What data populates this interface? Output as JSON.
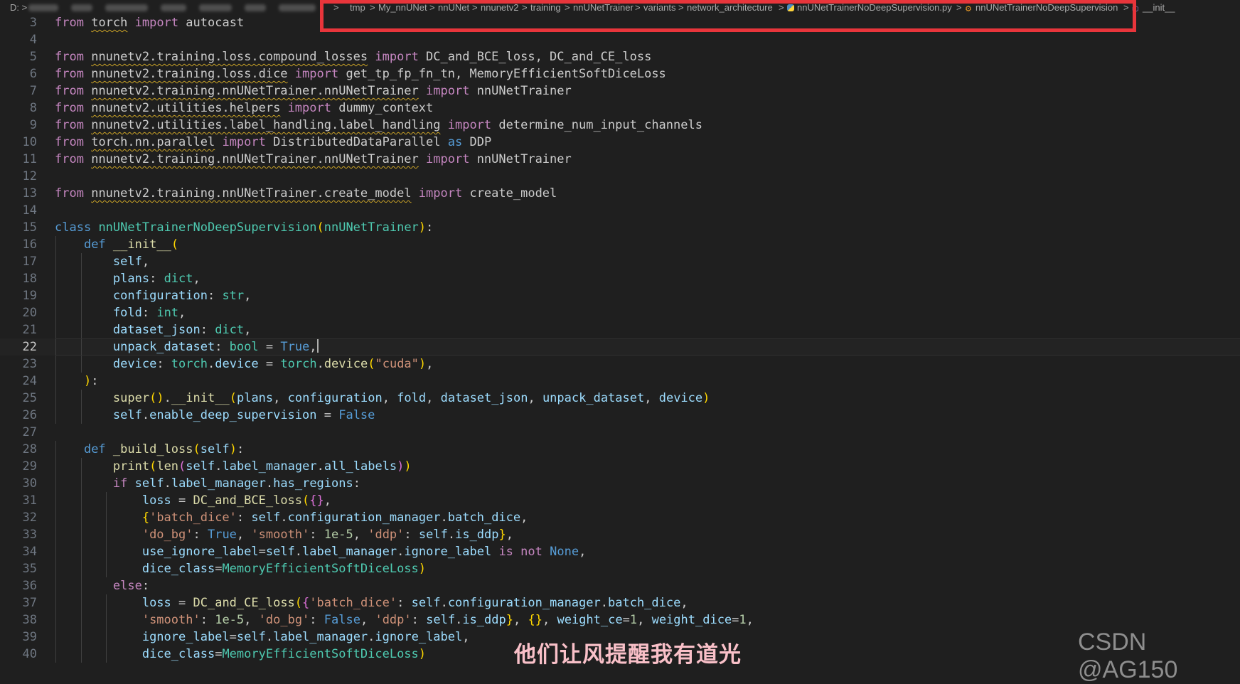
{
  "breadcrumb": {
    "drive": "D: >",
    "items": [
      "tmp",
      "My_nnUNet",
      "nnUNet",
      "nnunetv2",
      "training",
      "nnUNetTrainer",
      "variants",
      "network_architecture"
    ],
    "file_name": "nnUNetTrainerNoDeepSupervision.py",
    "class_name": "nnUNetTrainerNoDeepSupervision",
    "method_name": "__init__",
    "separator": ">"
  },
  "editor": {
    "active_line": 22,
    "lines": [
      {
        "n": "3",
        "t": "from torch import autocast"
      },
      {
        "n": "4",
        "t": ""
      },
      {
        "n": "5",
        "t": "from nnunetv2.training.loss.compound_losses import DC_and_BCE_loss, DC_and_CE_loss"
      },
      {
        "n": "6",
        "t": "from nnunetv2.training.loss.dice import get_tp_fp_fn_tn, MemoryEfficientSoftDiceLoss"
      },
      {
        "n": "7",
        "t": "from nnunetv2.training.nnUNetTrainer.nnUNetTrainer import nnUNetTrainer"
      },
      {
        "n": "8",
        "t": "from nnunetv2.utilities.helpers import dummy_context"
      },
      {
        "n": "9",
        "t": "from nnunetv2.utilities.label_handling.label_handling import determine_num_input_channels"
      },
      {
        "n": "10",
        "t": "from torch.nn.parallel import DistributedDataParallel as DDP"
      },
      {
        "n": "11",
        "t": "from nnunetv2.training.nnUNetTrainer.nnUNetTrainer import nnUNetTrainer"
      },
      {
        "n": "12",
        "t": ""
      },
      {
        "n": "13",
        "t": "from nnunetv2.training.nnUNetTrainer.create_model import create_model"
      },
      {
        "n": "14",
        "t": ""
      },
      {
        "n": "15",
        "t": "class nnUNetTrainerNoDeepSupervision(nnUNetTrainer):"
      },
      {
        "n": "16",
        "t": "    def __init__("
      },
      {
        "n": "17",
        "t": "        self,"
      },
      {
        "n": "18",
        "t": "        plans: dict,"
      },
      {
        "n": "19",
        "t": "        configuration: str,"
      },
      {
        "n": "20",
        "t": "        fold: int,"
      },
      {
        "n": "21",
        "t": "        dataset_json: dict,"
      },
      {
        "n": "22",
        "t": "        unpack_dataset: bool = True,"
      },
      {
        "n": "23",
        "t": "        device: torch.device = torch.device(\"cuda\"),"
      },
      {
        "n": "24",
        "t": "    ):"
      },
      {
        "n": "25",
        "t": "        super().__init__(plans, configuration, fold, dataset_json, unpack_dataset, device)"
      },
      {
        "n": "26",
        "t": "        self.enable_deep_supervision = False"
      },
      {
        "n": "27",
        "t": ""
      },
      {
        "n": "28",
        "t": "    def _build_loss(self):"
      },
      {
        "n": "29",
        "t": "        print(len(self.label_manager.all_labels))"
      },
      {
        "n": "30",
        "t": "        if self.label_manager.has_regions:"
      },
      {
        "n": "31",
        "t": "            loss = DC_and_BCE_loss({},"
      },
      {
        "n": "32",
        "t": "            {'batch_dice': self.configuration_manager.batch_dice,"
      },
      {
        "n": "33",
        "t": "            'do_bg': True, 'smooth': 1e-5, 'ddp': self.is_ddp},"
      },
      {
        "n": "34",
        "t": "            use_ignore_label=self.label_manager.ignore_label is not None,"
      },
      {
        "n": "35",
        "t": "            dice_class=MemoryEfficientSoftDiceLoss)"
      },
      {
        "n": "36",
        "t": "        else:"
      },
      {
        "n": "37",
        "t": "            loss = DC_and_CE_loss({'batch_dice': self.configuration_manager.batch_dice,"
      },
      {
        "n": "38",
        "t": "            'smooth': 1e-5, 'do_bg': False, 'ddp': self.is_ddp}, {}, weight_ce=1, weight_dice=1,"
      },
      {
        "n": "39",
        "t": "            ignore_label=self.label_manager.ignore_label,"
      },
      {
        "n": "40",
        "t": "            dice_class=MemoryEfficientSoftDiceLoss)"
      }
    ]
  },
  "watermarks": {
    "chinese": "他们让风提醒我有道光",
    "csdn": "CSDN @AG150"
  },
  "colors": {
    "background": "#1f1f1f",
    "highlight_box": "#e8353b",
    "keyword": "#569cd6",
    "control_keyword": "#c586c0",
    "class": "#4ec9b0",
    "function": "#dcdcaa",
    "variable": "#9cdcfe",
    "string": "#ce9178",
    "number": "#b5cea8"
  }
}
